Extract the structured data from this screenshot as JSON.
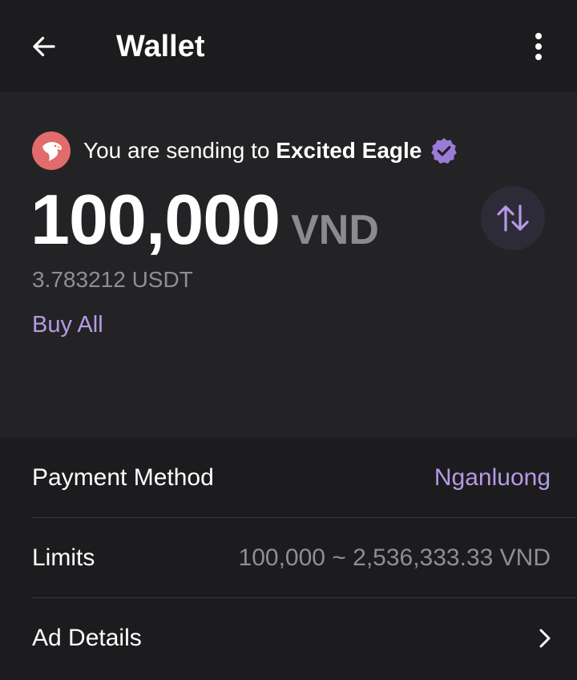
{
  "header": {
    "title": "Wallet",
    "back_icon": "arrow-left-icon",
    "menu_icon": "more-vertical-icon"
  },
  "recipient": {
    "prefix": "You are sending to ",
    "name": "Excited Eagle",
    "avatar_icon": "eagle-avatar-icon",
    "verified_icon": "verified-badge-icon"
  },
  "amount": {
    "value": "100,000",
    "currency": "VND",
    "converted": "3.783212 USDT",
    "swap_icon": "swap-vertical-icon",
    "buy_all_label": "Buy All"
  },
  "details": {
    "payment_method": {
      "label": "Payment Method",
      "value": "Nganluong"
    },
    "limits": {
      "label": "Limits",
      "value": "100,000 ~ 2,536,333.33 VND"
    },
    "ad_details": {
      "label": "Ad Details",
      "icon": "chevron-right-icon"
    }
  },
  "colors": {
    "background": "#1c1c1e",
    "card": "#232325",
    "accent": "#b59ae6",
    "muted": "#8e8e93",
    "avatar": "#e26b6b",
    "swap_bg": "#2e2b38"
  }
}
